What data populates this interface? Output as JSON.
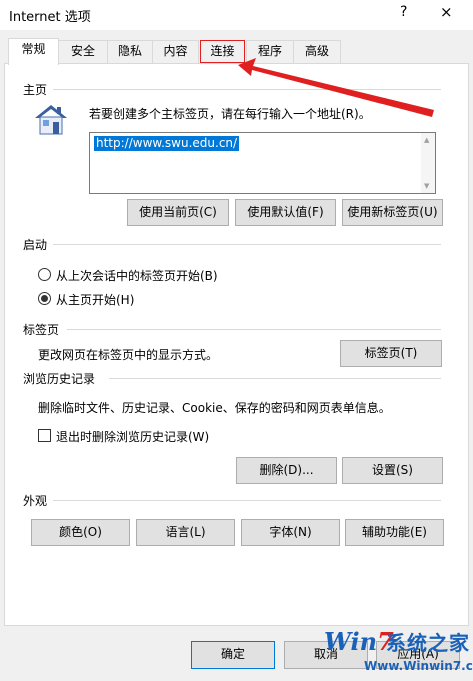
{
  "window": {
    "title": "Internet 选项",
    "help": "?",
    "close": "×"
  },
  "tabs": [
    {
      "label": "常规"
    },
    {
      "label": "安全"
    },
    {
      "label": "隐私"
    },
    {
      "label": "内容"
    },
    {
      "label": "连接"
    },
    {
      "label": "程序"
    },
    {
      "label": "高级"
    }
  ],
  "homepage": {
    "heading": "主页",
    "instruction": "若要创建多个主标签页，请在每行输入一个地址(R)。",
    "url": "http://www.swu.edu.cn/",
    "buttons": {
      "use_current": "使用当前页(C)",
      "use_default": "使用默认值(F)",
      "use_new_tab": "使用新标签页(U)"
    }
  },
  "startup": {
    "heading": "启动",
    "option_last_session": "从上次会话中的标签页开始(B)",
    "option_home_page": "从主页开始(H)",
    "selected": "home_page"
  },
  "tabs_section": {
    "heading": "标签页",
    "description": "更改网页在标签页中的显示方式。",
    "button": "标签页(T)"
  },
  "history": {
    "heading": "浏览历史记录",
    "description": "删除临时文件、历史记录、Cookie、保存的密码和网页表单信息。",
    "checkbox_label": "退出时删除浏览历史记录(W)",
    "checked": false,
    "buttons": {
      "delete": "删除(D)...",
      "settings": "设置(S)"
    }
  },
  "appearance": {
    "heading": "外观",
    "buttons": {
      "colors": "颜色(O)",
      "languages": "语言(L)",
      "fonts": "字体(N)",
      "accessibility": "辅助功能(E)"
    }
  },
  "footer": {
    "ok": "确定",
    "cancel": "取消",
    "apply": "应用(A)"
  },
  "watermark": {
    "logo_w": "Win",
    "logo_7": "7",
    "brand": "系统之家",
    "url": "Www.Winwin7.com"
  },
  "colors": {
    "accent": "#0078d7",
    "highlight_red": "#e02020",
    "panel_bg": "#ffffff",
    "window_bg": "#f0f0f0"
  }
}
